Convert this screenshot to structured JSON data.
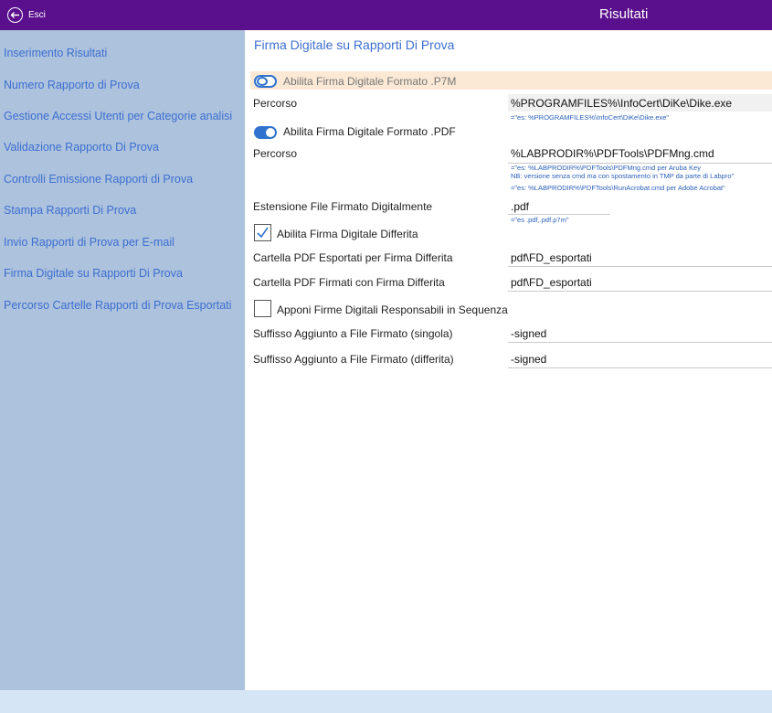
{
  "header": {
    "back_label": "Esci",
    "title": "Risultati"
  },
  "sidebar": {
    "items": [
      {
        "label": "Inserimento Risultati"
      },
      {
        "label": "Numero Rapporto di Prova"
      },
      {
        "label": "Gestione Accessi Utenti per Categorie analisi"
      },
      {
        "label": "Validazione Rapporto Di Prova"
      },
      {
        "label": "Controlli  Emissione Rapporti di Prova"
      },
      {
        "label": "Stampa Rapporti Di Prova"
      },
      {
        "label": "Invio Rapporti di Prova per E-mail"
      },
      {
        "label": "Firma Digitale su Rapporti Di Prova"
      },
      {
        "label": "Percorso Cartelle Rapporti di Prova Esportati"
      }
    ]
  },
  "main": {
    "title": "Firma Digitale su Rapporti Di Prova",
    "p7m": {
      "toggle_label": "Abilita Firma Digitale Formato .P7M",
      "toggle_on": false,
      "path_label": "Percorso",
      "path_value": "%PROGRAMFILES%\\InfoCert\\DiKe\\Dike.exe",
      "path_hint": "=\"es: %PROGRAMFILES%\\InfoCert\\DiKe\\Dike.exe\""
    },
    "pdf": {
      "toggle_label": "Abilita Firma Digitale Formato .PDF",
      "toggle_on": true,
      "path_label": "Percorso",
      "path_value": "%LABPRODIR%\\PDFTools\\PDFMng.cmd",
      "hint_1": "=\"es: %LABPRODIR%\\PDFTools\\PDFMng.cmd   per Aruba Key",
      "hint_2": "NB: versione senza cmd ma con spostamento in TMP da parte di Labpro\"",
      "hint_3": "=\"es: %LABPRODIR%\\PDFTools\\RunAcrobat.cmd  per Adobe Acrobat\""
    },
    "extension": {
      "label": "Estensione File Firmato Digitalmente",
      "value": ".pdf",
      "hint": "=\"es .pdf,.pdf.p7m\""
    },
    "deferred": {
      "checkbox_label": "Abilita Firma Digitale Differita",
      "checked": true,
      "export_label": "Cartella PDF Esportati per Firma Differita",
      "export_value": "pdf\\FD_esportati",
      "signed_label": "Cartella PDF Firmati con Firma Differita",
      "signed_value": "pdf\\FD_esportati"
    },
    "sequence": {
      "checkbox_label": "Apponi Firme Digitali Responsabili in Sequenza",
      "checked": false
    },
    "suffix_single": {
      "label": "Suffisso Aggiunto a File Firmato (singola)",
      "value": "-signed"
    },
    "suffix_deferred": {
      "label": "Suffisso Aggiunto a File Firmato (differita)",
      "value": "-signed"
    }
  },
  "colors": {
    "header_bg": "#5a0f8c",
    "sidebar_bg": "#adc2dd",
    "accent_blue": "#3d6fd0",
    "band_bg": "#fbe9d6",
    "footer_bg": "#d6e5f5"
  }
}
